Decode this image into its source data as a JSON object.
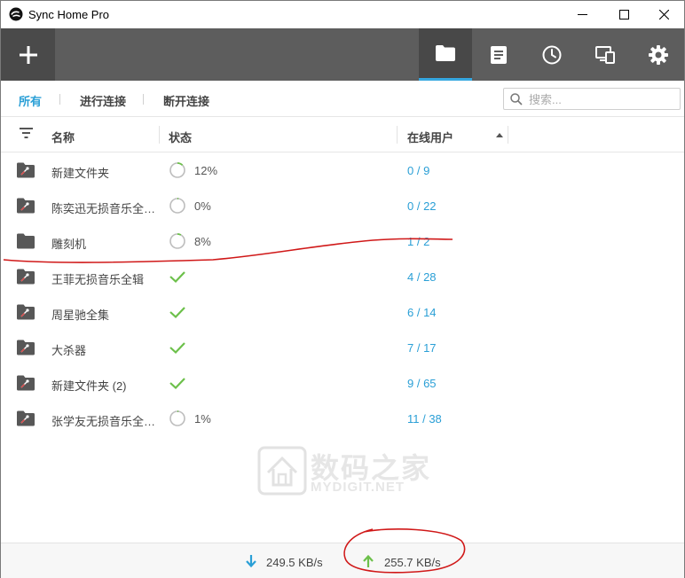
{
  "window": {
    "title": "Sync Home Pro"
  },
  "toolbar": {
    "add_icon": "plus-icon",
    "buttons": [
      {
        "id": "folders",
        "icon": "folder-icon",
        "active": true
      },
      {
        "id": "log",
        "icon": "document-icon",
        "active": false
      },
      {
        "id": "history",
        "icon": "clock-icon",
        "active": false
      },
      {
        "id": "devices",
        "icon": "devices-icon",
        "active": false
      },
      {
        "id": "settings",
        "icon": "gear-icon",
        "active": false
      }
    ]
  },
  "filter": {
    "tabs": [
      "所有",
      "进行连接",
      "断开连接"
    ],
    "active_tab": "所有",
    "search_placeholder": "搜索..."
  },
  "table": {
    "headers": {
      "name": "名称",
      "status": "状态",
      "users": "在线用户"
    },
    "rows": [
      {
        "name": "新建文件夹",
        "status": "progress",
        "progress": "12%",
        "users": "0 / 9",
        "icon": "shared-folder-icon"
      },
      {
        "name": "陈奕迅无损音乐全…",
        "status": "progress",
        "progress": "0%",
        "users": "0 / 22",
        "icon": "shared-folder-icon"
      },
      {
        "name": "雕刻机",
        "status": "progress",
        "progress": "8%",
        "users": "1 / 2",
        "icon": "folder-icon"
      },
      {
        "name": "王菲无损音乐全辑",
        "status": "done",
        "progress": "",
        "users": "4 / 28",
        "icon": "shared-folder-icon"
      },
      {
        "name": "周星驰全集",
        "status": "done",
        "progress": "",
        "users": "6 / 14",
        "icon": "shared-folder-icon"
      },
      {
        "name": "大杀器",
        "status": "done",
        "progress": "",
        "users": "7 / 17",
        "icon": "shared-folder-icon"
      },
      {
        "name": "新建文件夹 (2)",
        "status": "done",
        "progress": "",
        "users": "9 / 65",
        "icon": "shared-folder-icon"
      },
      {
        "name": "张学友无损音乐全…",
        "status": "progress",
        "progress": "1%",
        "users": "11 / 38",
        "icon": "shared-folder-icon"
      }
    ]
  },
  "watermark": {
    "text": "数码之家",
    "sub": "MYDIGIT.NET"
  },
  "statusbar": {
    "download_rate": "249.5 KB/s",
    "upload_rate": "255.7 KB/s"
  },
  "colors": {
    "accent": "#2a9fd6",
    "toolbar": "#5d5d5d",
    "check": "#6cc04a",
    "annotation": "#d01818"
  }
}
